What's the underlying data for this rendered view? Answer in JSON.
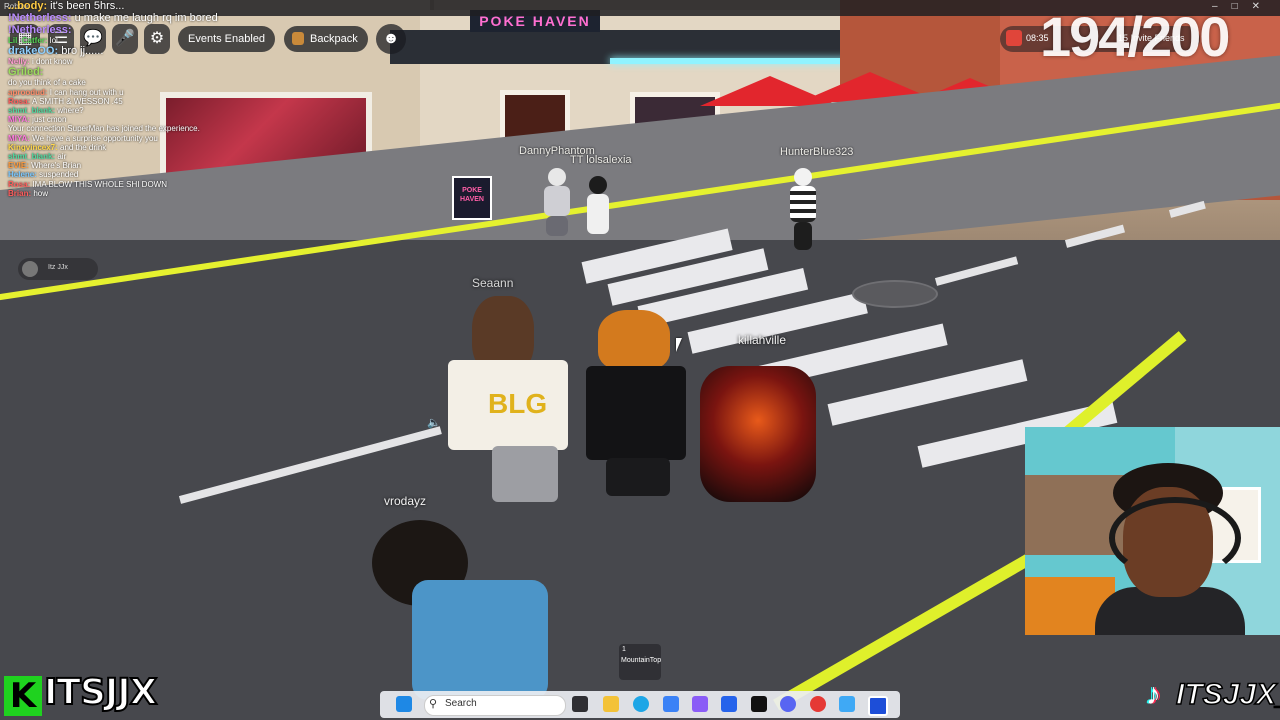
{
  "window": {
    "title": "Roblox"
  },
  "toolbar": {
    "events_label": "Events Enabled",
    "backpack_label": "Backpack"
  },
  "top_right": {
    "time": "08:35",
    "invite": "15 Invite Friends"
  },
  "counter": "194/200",
  "chat": [
    {
      "name": "...body:",
      "text": " it's been 5hrs...",
      "color": "#ffcc44",
      "big": true
    },
    {
      "name": "!Netherless:",
      "text": " u make me laugh rq im bored",
      "color": "#b98cff",
      "big": true
    },
    {
      "name": "!Netherless:",
      "text": "",
      "color": "#b98cff",
      "big": true
    },
    {
      "name": "Lil_Catfer:",
      "text": " lol",
      "color": "#57d957",
      "big": false
    },
    {
      "name": "drakeOO:",
      "text": " bro jj......",
      "color": "#8fd0ff",
      "big": true
    },
    {
      "name": "Nelly:",
      "text": " i dont know",
      "color": "#ff9bd2",
      "big": false
    },
    {
      "name": "Griled:",
      "text": "",
      "color": "#9bdc5c",
      "big": true
    },
    {
      "name": "",
      "text": "do you think of a cake",
      "color": "#ffffff",
      "big": false
    },
    {
      "name": "aproodud:",
      "text": " I can hang out with u",
      "color": "#ff8c69",
      "big": false
    },
    {
      "name": "Rosa:",
      "text": " A SMITH & WESSON .45",
      "color": "#ff5c5c",
      "big": false
    },
    {
      "name": "shmt_blank:",
      "text": " where?",
      "color": "#4fd9a0",
      "big": false
    },
    {
      "name": "MIYA:",
      "text": " just cmon",
      "color": "#ff7be0",
      "big": false
    },
    {
      "name": "",
      "text": "Your connection SuperMan has joined the experience.",
      "color": "#ffffff",
      "big": false
    },
    {
      "name": "MIYA:",
      "text": " We have a surprise opportunity you",
      "color": "#ff7be0",
      "big": false
    },
    {
      "name": "Kingvincex7:",
      "text": " and the drink",
      "color": "#ffd84a",
      "big": false
    },
    {
      "name": "shmt_blank:",
      "text": " air",
      "color": "#4fd9a0",
      "big": false
    },
    {
      "name": "EVIE:",
      "text": " Where's Brian",
      "color": "#ff9b3d",
      "big": false
    },
    {
      "name": "Helene:",
      "text": " suspended",
      "color": "#7ac8ff",
      "big": false
    },
    {
      "name": "Rosa:",
      "text": " IMA BLOW THIS WHOLE SHI DOWN",
      "color": "#ff5c5c",
      "big": false
    },
    {
      "name": "Brian:",
      "text": " how",
      "color": "#ff5c5c",
      "big": false
    }
  ],
  "name_tags": {
    "danny": "DannyPhantom",
    "lolsalexia": "TT lolsalexia",
    "hunter": "HunterBlue323",
    "seaann": "Seaann",
    "killahville": "killahville",
    "vrodayz": "vrodayz"
  },
  "signs": {
    "poke_haven": "POKE HAVEN",
    "neon": "POKE HAVEN"
  },
  "voice": {
    "name": "Itz JJx"
  },
  "hotbar": {
    "slot": "1",
    "item": "MountainTop"
  },
  "taskbar": {
    "search_placeholder": "Search"
  },
  "brand": {
    "left": "ITSJJX",
    "right": "ITSJJX__"
  }
}
